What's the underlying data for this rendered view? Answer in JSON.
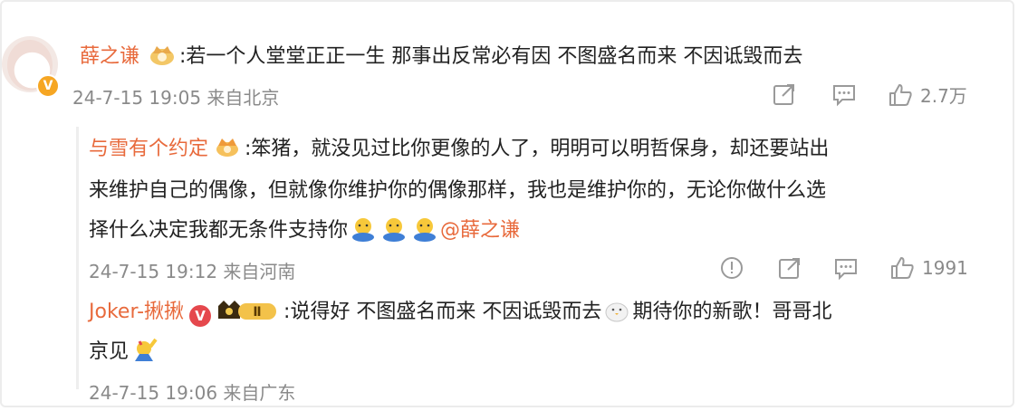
{
  "post": {
    "author": "薛之谦",
    "text": ":若一个人堂堂正正一生 那事出反常必有因 不图盛名而来 不因诋毁而去",
    "time": "24-7-15 19:05 来自北京",
    "likes": "2.7万"
  },
  "replies": [
    {
      "author": "与雪有个约定",
      "line1": ":笨猪，就没见过比你更像的人了，明明可以明哲保身，却还要站出",
      "line2": "来维护自己的偶像，但就像你维护你的偶像那样，我也是维护你的，无论你做什么选",
      "line3_text": "择什么决定我都无条件支持你",
      "mention": "@薛之谦",
      "time": "24-7-15 19:12 来自河南",
      "likes": "1991"
    },
    {
      "author": "Joker-揪揪",
      "level_badge": "Ⅱ",
      "line1": ":说得好 不图盛名而来 不因诋毁而去",
      "line1_after": "期待你的新歌！哥哥北",
      "line2": "京见",
      "time": "24-7-15 19:06 来自广东"
    }
  ],
  "icons": [
    "share-icon",
    "comment-icon",
    "like-icon",
    "report-icon",
    "crown-icon",
    "verified-icon"
  ],
  "colors": {
    "name": "#e86a3c",
    "meta": "#8a8a8a",
    "verified": "#e5484d"
  }
}
